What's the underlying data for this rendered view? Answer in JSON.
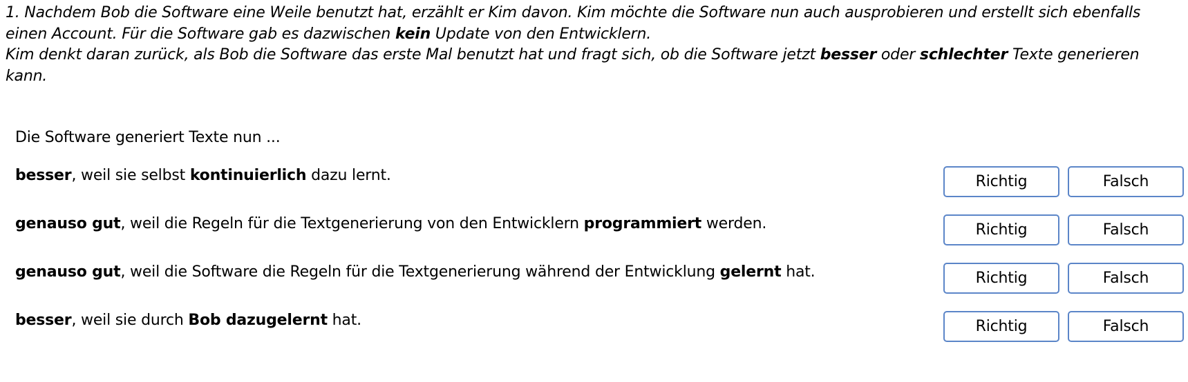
{
  "intro": {
    "line1_a": "1. Nachdem Bob die Software eine Weile benutzt hat, erzählt er Kim davon. Kim möchte die Software nun auch ausprobieren und erstellt sich ebenfalls einen Account. Für die Software gab es dazwischen ",
    "line1_bold": "kein",
    "line1_b": " Update von den Entwicklern.",
    "line2_a": "Kim denkt daran zurück, als Bob die Software das erste Mal benutzt hat und fragt sich, ob die Software jetzt ",
    "line2_bold1": "besser",
    "line2_mid": " oder ",
    "line2_bold2": "schlechter",
    "line2_b": " Texte generieren kann."
  },
  "lead": "Die Software generiert Texte nun ...",
  "statements": [
    {
      "bold1": "besser",
      "text1": ", weil sie selbst ",
      "bold2": "kontinuierlich",
      "text2": " dazu lernt."
    },
    {
      "bold1": "genauso gut",
      "text1": ", weil die Regeln für die Textgenerierung von den Entwicklern ",
      "bold2": "programmiert",
      "text2": " werden."
    },
    {
      "bold1": "genauso gut",
      "text1": ", weil die Software die Regeln für die Textgenerierung während der Entwicklung ",
      "bold2": "gelernt",
      "text2": " hat."
    },
    {
      "bold1": "besser",
      "text1": ", weil sie durch ",
      "bold2": "Bob dazugelernt",
      "text2": " hat."
    }
  ],
  "buttons": {
    "true_label": "Richtig",
    "false_label": "Falsch"
  }
}
